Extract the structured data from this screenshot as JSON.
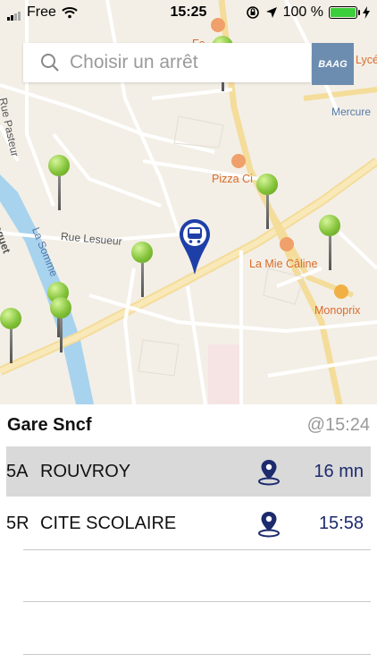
{
  "status_bar": {
    "carrier": "Free",
    "time": "15:25",
    "battery": "100 %",
    "battery_level": 1.0
  },
  "search": {
    "placeholder": "Choisir un arrêt"
  },
  "logo": {
    "text": "BAAG"
  },
  "map": {
    "labels": {
      "rue_pasteur": "Rue Pasteur",
      "pizza": "Pizza Ci",
      "rue_lesueur": "Rue Lesueur",
      "la_somme": "La Somme",
      "mie_caline": "La Mie Câline",
      "monoprix": "Monoprix",
      "mercure": "Mercure",
      "lycee": "Lycé",
      "jocquet": "locquet",
      "fe": "Fe"
    }
  },
  "stop": {
    "name": "Gare Sncf",
    "time": "@15:24"
  },
  "departures": [
    {
      "line": "5A",
      "destination": "ROUVROY",
      "eta": "16 mn",
      "selected": true
    },
    {
      "line": "5R",
      "destination": "CITE SCOLAIRE",
      "eta": "15:58",
      "selected": false
    }
  ],
  "colors": {
    "accent": "#1c2a6e",
    "pin_green": "#84c33a",
    "selected_row": "#d9d9d9"
  }
}
